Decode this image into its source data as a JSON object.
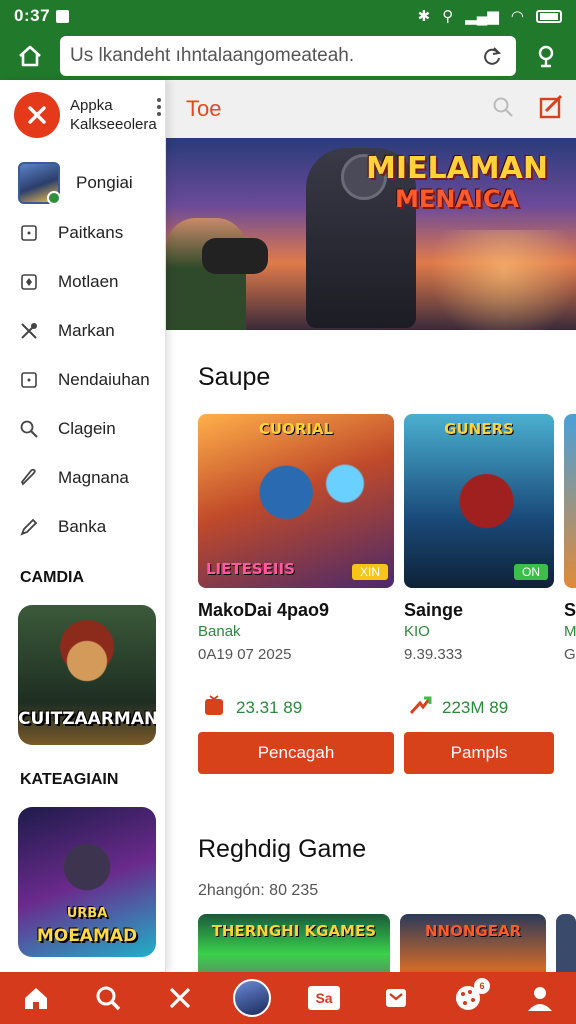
{
  "status_bar": {
    "time": "0:37",
    "icons": [
      "app-badge-icon",
      "bluetooth-icon",
      "location-icon",
      "signal-icon",
      "wifi-icon",
      "battery-icon"
    ]
  },
  "url_bar": {
    "value": "Us lkandeht ıhntalaangomeateah.",
    "icons": [
      "home-icon",
      "reload-icon",
      "mic-icon"
    ]
  },
  "drawer": {
    "title_line1": "Appka",
    "title_line2": "Kalkseeolera",
    "profile_name": "Pongiai",
    "items": [
      {
        "label": "Paitkans",
        "icon": "square-icon"
      },
      {
        "label": "Motlaen",
        "icon": "diamond-icon"
      },
      {
        "label": "Markan",
        "icon": "tools-icon"
      },
      {
        "label": "Nendaiuhan",
        "icon": "square-icon"
      },
      {
        "label": "Clagein",
        "icon": "search-icon"
      },
      {
        "label": "Magnana",
        "icon": "tag-icon"
      },
      {
        "label": "Banka",
        "icon": "pencil-icon"
      }
    ],
    "section1": "CAMDIA",
    "art1_caption": "CUITZAARMAN",
    "section2": "KATEAGIAIN",
    "art2_caption_line1": "URBA",
    "art2_caption_line2": "MOEAMAD"
  },
  "main": {
    "title": "Toe",
    "hero": {
      "title_line1": "MIELAMAN",
      "title_line2": "MENAICA"
    },
    "section1": {
      "title": "Saupe",
      "cards": [
        {
          "thumb_tag": "CUORIAL",
          "thumb_bottom": "LIETESEIIS",
          "badge": "XIN",
          "name": "MakoDai 4pao9",
          "publisher": "Banak",
          "date": "0A19 07 2025",
          "stat": "23.31 89",
          "button": "Pencagah"
        },
        {
          "thumb_tag": "GUNERS",
          "badge": "ON",
          "name": "Sainge",
          "publisher": "KIO",
          "date": "9.39.333",
          "stat": "223M 89",
          "button": "Pampls"
        },
        {
          "name": "Sε",
          "publisher": "M(",
          "date": "Gr"
        }
      ]
    },
    "section2": {
      "title": "Reghdig Game",
      "subtitle": "2hangón: 80 235",
      "thumbs": [
        "THERNGHI KGAMES",
        "NNONGEAR"
      ]
    }
  },
  "bottom_nav": {
    "items": [
      "home-icon",
      "search-icon",
      "close-icon",
      "avatar",
      "store-icon",
      "bookmark-icon",
      "games-icon",
      "profile-icon"
    ],
    "store_label": "Sa",
    "games_badge": "6"
  },
  "colors": {
    "status_green": "#217a2c",
    "accent_red": "#d63a1c",
    "stat_green": "#2a8a3a"
  }
}
